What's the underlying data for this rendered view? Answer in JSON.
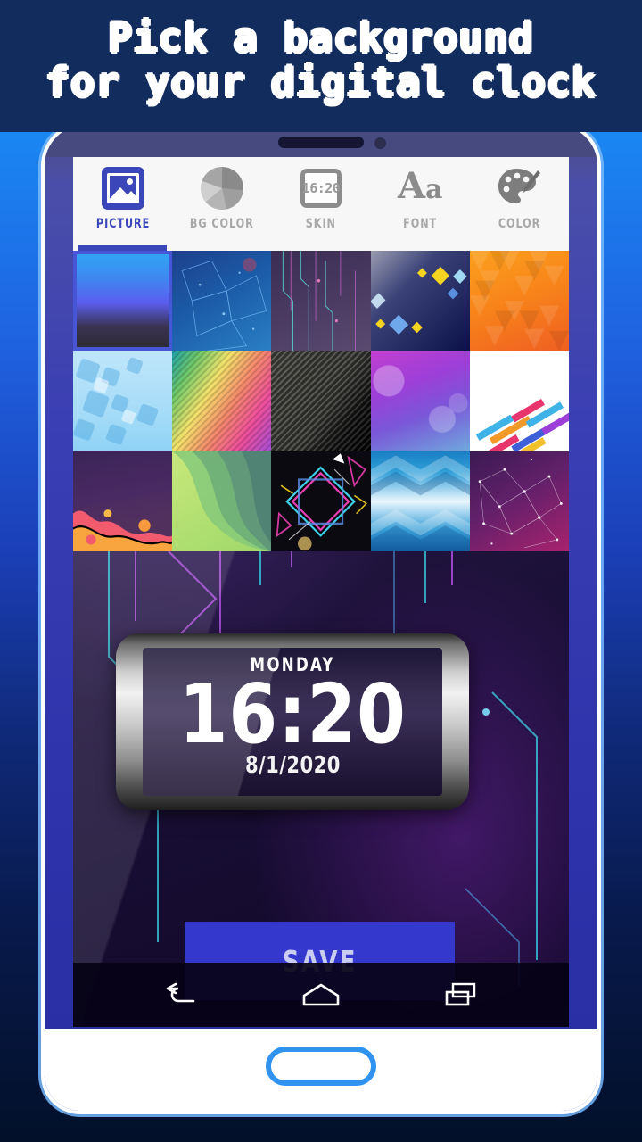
{
  "header": {
    "line1": "Pick a background",
    "line2": "for your digital clock",
    "bg_color": "#132c5e"
  },
  "app": {
    "accent_color": "#3b46b8",
    "tabs": [
      {
        "label": "PICTURE",
        "icon": "picture-icon",
        "active": true
      },
      {
        "label": "BG COLOR",
        "icon": "pie-chart-icon",
        "active": false
      },
      {
        "label": "SKIN",
        "icon": "skin-frame-icon",
        "active": false,
        "icon_text": "16:20"
      },
      {
        "label": "FONT",
        "icon": "font-aa-icon",
        "active": false
      },
      {
        "label": "COLOR",
        "icon": "palette-icon",
        "active": false
      }
    ],
    "wallpapers": [
      {
        "name": "blue-gradient",
        "selected": true
      },
      {
        "name": "blue-low-poly",
        "selected": false
      },
      {
        "name": "purple-circuit",
        "selected": false
      },
      {
        "name": "navy-yellow-diamonds",
        "selected": false
      },
      {
        "name": "orange-triangles",
        "selected": false
      },
      {
        "name": "light-blue-squares",
        "selected": false
      },
      {
        "name": "rainbow-diagonal",
        "selected": false
      },
      {
        "name": "carbon-fiber",
        "selected": false
      },
      {
        "name": "purple-bokeh",
        "selected": false
      },
      {
        "name": "white-color-arrows",
        "selected": false
      },
      {
        "name": "purple-orange-liquid",
        "selected": false
      },
      {
        "name": "green-waves",
        "selected": false
      },
      {
        "name": "neon-diamond",
        "selected": false
      },
      {
        "name": "blue-chevrons",
        "selected": false
      },
      {
        "name": "purple-network",
        "selected": false
      }
    ],
    "clock": {
      "day": "MONDAY",
      "time": "16:20",
      "date": "8/1/2020"
    },
    "save_label": "SAVE",
    "navbar": {
      "back": "back-icon",
      "home": "home-icon",
      "recents": "recents-icon"
    }
  }
}
